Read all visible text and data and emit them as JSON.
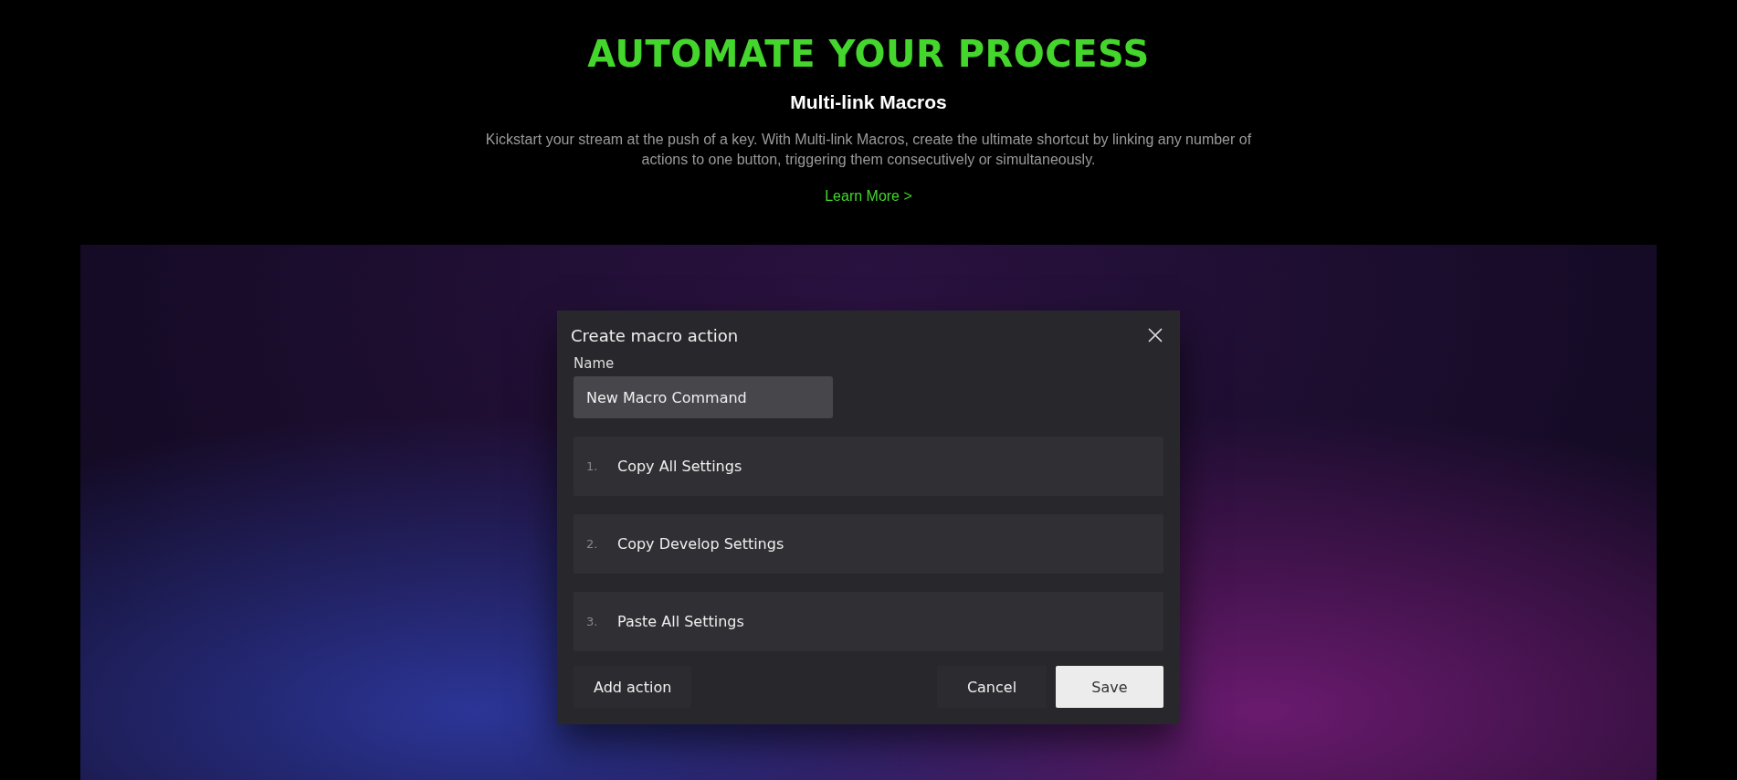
{
  "header": {
    "title": "AUTOMATE YOUR PROCESS",
    "subtitle": "Multi-link Macros",
    "description": "Kickstart your stream at the push of a key. With Multi-link Macros, create the ultimate shortcut by linking any number of actions to one button, triggering them consecutively or simultaneously.",
    "link": "Learn More >"
  },
  "dialog": {
    "title": "Create macro action",
    "name_label": "Name",
    "name_value": "New Macro Command",
    "actions": [
      {
        "number": "1.",
        "label": "Copy All Settings"
      },
      {
        "number": "2.",
        "label": "Copy Develop Settings"
      },
      {
        "number": "3.",
        "label": "Paste All Settings"
      }
    ],
    "buttons": {
      "add": "Add action",
      "cancel": "Cancel",
      "save": "Save"
    }
  }
}
